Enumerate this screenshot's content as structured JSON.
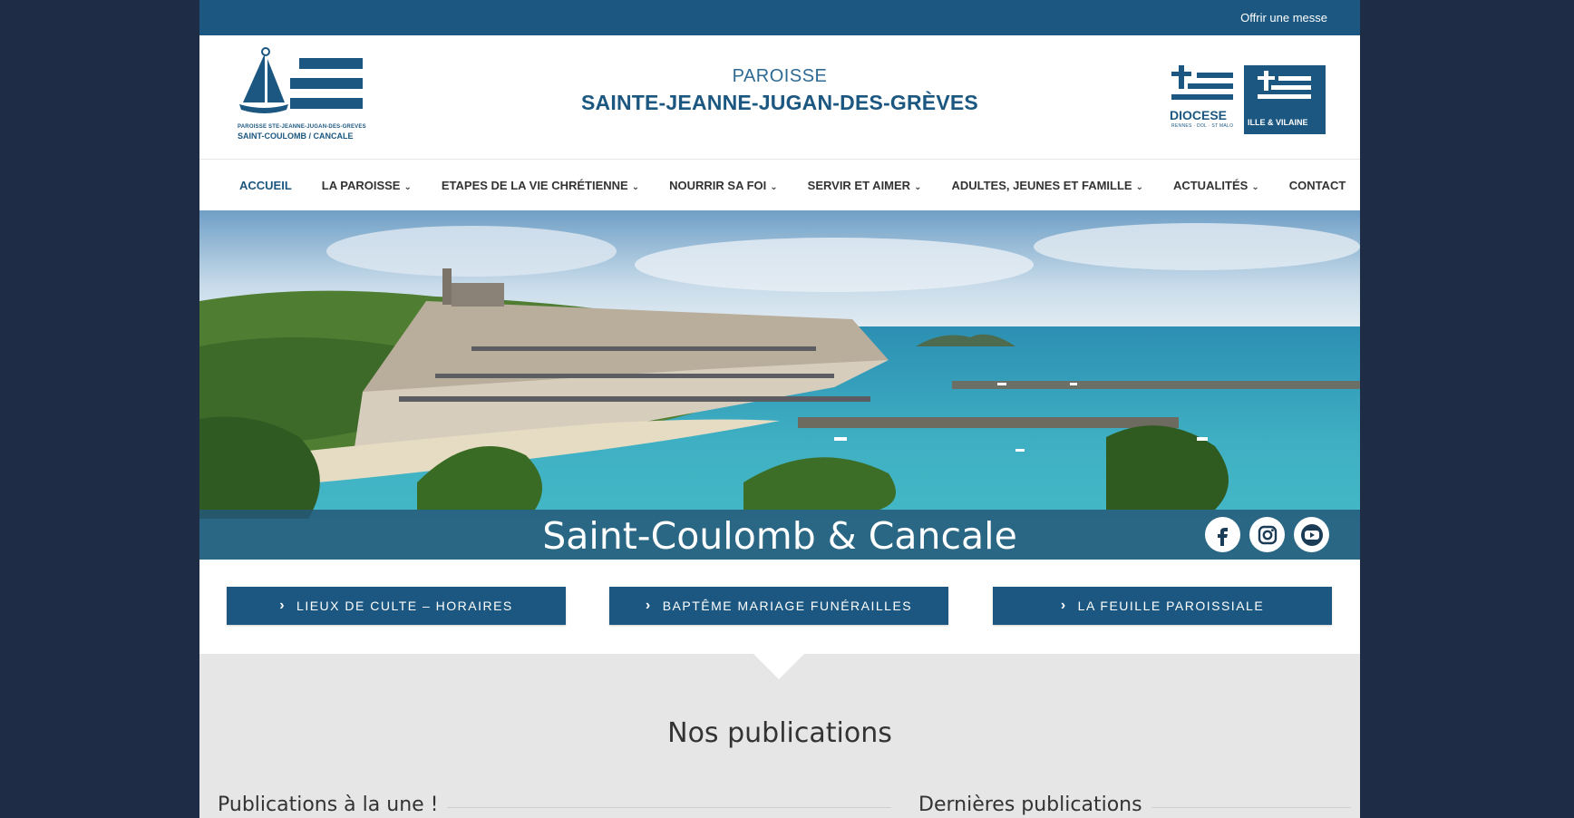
{
  "topbar": {
    "link": "Offrir une messe"
  },
  "header": {
    "logo_line1": "PAROISSE STE-JEANNE-JUGAN-DES-GREVES",
    "logo_line2": "SAINT-COULOMB / CANCALE",
    "pre_title": "PAROISSE",
    "title": "SAINTE-JEANNE-JUGAN-DES-GRÈVES",
    "diocese_label": "DIOCESE",
    "diocese_sub": "RENNES · DOL · ST MALO",
    "diocese_box": "ILLE & VILAINE"
  },
  "nav": {
    "items": [
      {
        "label": "ACCUEIL",
        "dropdown": false
      },
      {
        "label": "LA PAROISSE",
        "dropdown": true
      },
      {
        "label": "ETAPES DE LA VIE CHRÉTIENNE",
        "dropdown": true
      },
      {
        "label": "NOURRIR SA FOI",
        "dropdown": true
      },
      {
        "label": "SERVIR ET AIMER",
        "dropdown": true
      },
      {
        "label": "ADULTES, JEUNES ET FAMILLE",
        "dropdown": true
      },
      {
        "label": "ACTUALITÉS",
        "dropdown": true
      },
      {
        "label": "CONTACT",
        "dropdown": false
      }
    ]
  },
  "hero": {
    "title": "Saint-Coulomb & Cancale",
    "social": [
      "facebook-icon",
      "instagram-icon",
      "youtube-icon"
    ]
  },
  "buttons": [
    "LIEUX DE CULTE – HORAIRES",
    "BAPTÊME MARIAGE FUNÉRAILLES",
    "LA FEUILLE PAROISSIALE"
  ],
  "publications": {
    "title": "Nos publications",
    "left": "Publications à la une !",
    "right": "Dernières publications"
  },
  "colors": {
    "brand": "#1b5780",
    "background": "#1e2d45"
  }
}
